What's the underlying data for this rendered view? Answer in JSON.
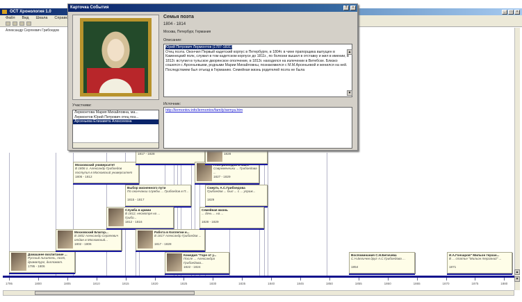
{
  "app": {
    "title": "ОСТ Хронология 1.0",
    "menu": [
      "Файл",
      "Вид",
      "Шкала",
      "Справка"
    ],
    "tree_item": "Александр Сергеевич Грибоедов"
  },
  "timeline": {
    "axis_years": [
      "1795",
      "1800",
      "1805",
      "1810",
      "1815",
      "1820",
      "1825",
      "1830",
      "1835",
      "1840",
      "1845",
      "1850",
      "1855",
      "1860",
      "1865",
      "1870",
      "1875",
      "1880"
    ],
    "events": [
      {
        "title": "Домашнее воспитание ...",
        "text": "Русский писатель, поэт, драматург, дипломат. Алекс...",
        "dates": "1795 - 1806",
        "image": true
      },
      {
        "title": "Московский Благор...",
        "text": "В 1802 Александр Сергеевич отдан в Московский...",
        "dates": "1802 - 1806",
        "image": true
      },
      {
        "title": "Московский университет",
        "text": "В 1806 г. Александр Грибоедов поступил в Московский университет",
        "dates": "1806 - 1812",
        "image": false
      },
      {
        "title": "Выбор жизненного пути",
        "text": "По окончании службы ... Грибоедов в П...",
        "dates": "1815 - 1817",
        "image": false
      },
      {
        "title": "Служба в армии",
        "text": "В 1812, несмотря на ... Грибо...",
        "dates": "1812 - 1816",
        "image": true
      },
      {
        "title": "Работа в Коллегии и...",
        "text": "В 1817 Александр Грибоедов ...",
        "dates": "1817 - 1828",
        "image": true
      },
      {
        "title": "",
        "text": "",
        "dates": "1817 - 1828",
        "image": false
      },
      {
        "title": "Комедия \"Горе от у...",
        "text": "После ... Александра Грибоедова...",
        "dates": "1822 - 1824",
        "image": true
      },
      {
        "title": "А.С.Грибоедов в Кав...",
        "text": "Современники ... Грибоедова ...",
        "dates": "1827 - 1829",
        "image": true
      },
      {
        "title": "Смерть А.С.Грибоедова",
        "text": "Грибоедов ... был ... с ... упраж...",
        "dates": "1829",
        "image": false
      },
      {
        "title": "Семейная жизнь",
        "text": "... дочь ... на ...",
        "dates": "1828 - 1829",
        "image": false
      },
      {
        "title": "",
        "text": "",
        "dates": "1828",
        "image": true
      },
      {
        "title": "Воспоминания С.Н.Бегичева",
        "text": "С.Н.Бегичев друг А.С.Грибоедова ...",
        "dates": "1854",
        "image": false
      },
      {
        "title": "И.А.Гончаров\" Мильон терзан...",
        "text": "В ... статье \"Мильон терзаний\" ...",
        "dates": "1871",
        "image": false
      }
    ]
  },
  "dialog": {
    "title": "Карточка События",
    "event_name": "Семья поэта",
    "event_dates": "1804 - 1814",
    "event_places": "Москва, Петербург, Германия",
    "description_label": "Описание:",
    "description_first": "Юрий Петрович Лермонтов (1787-1831)",
    "description_rest": "Отец поэта. Окончил Первый кадетский корпус в Петербурге, в 1804г. в чине прапорщика выпущен в Каменецкий полк, служил в том кадетском корпусе до 1811г., по болезни вышел в отставку и жил в имении, в 1812г. вступил в тульское дворянское ополчение, в 1813г. находился на излечении в Витебске. Близко сошелся с Арсеньевыми, родными Марии Михайловны, познакомился с М.М.Арсеньевой и женился на ней. Последствием был отъезд в Германию. Семейная жизнь родителей поэта не была",
    "members_label": "Участники:",
    "members": [
      "Лермонтова Мария Михайловна, ма...",
      "Лермонтов Юрий Петрович отец поэ...",
      "Арсеньева Елизавета Алексеевна"
    ],
    "sources_label": "Источник:",
    "source_link": "http://lermontov.info/lermontov/family/semya.htm"
  }
}
